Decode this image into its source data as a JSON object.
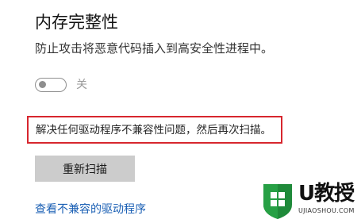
{
  "section": {
    "title": "内存完整性",
    "description": "防止攻击将恶意代码插入到高安全性进程中。"
  },
  "toggle": {
    "state_label": "关",
    "is_on": false
  },
  "warning": {
    "text": "解决任何驱动程序不兼容性问题，然后再次扫描。",
    "border_color": "#d7262e"
  },
  "actions": {
    "rescan_label": "重新扫描",
    "incompatible_drivers_link": "查看不兼容的驱动程序"
  },
  "watermark": {
    "brand": "U教授",
    "domain": "UJIAOSHOU.COM",
    "accent_color": "#1f8a3a"
  }
}
